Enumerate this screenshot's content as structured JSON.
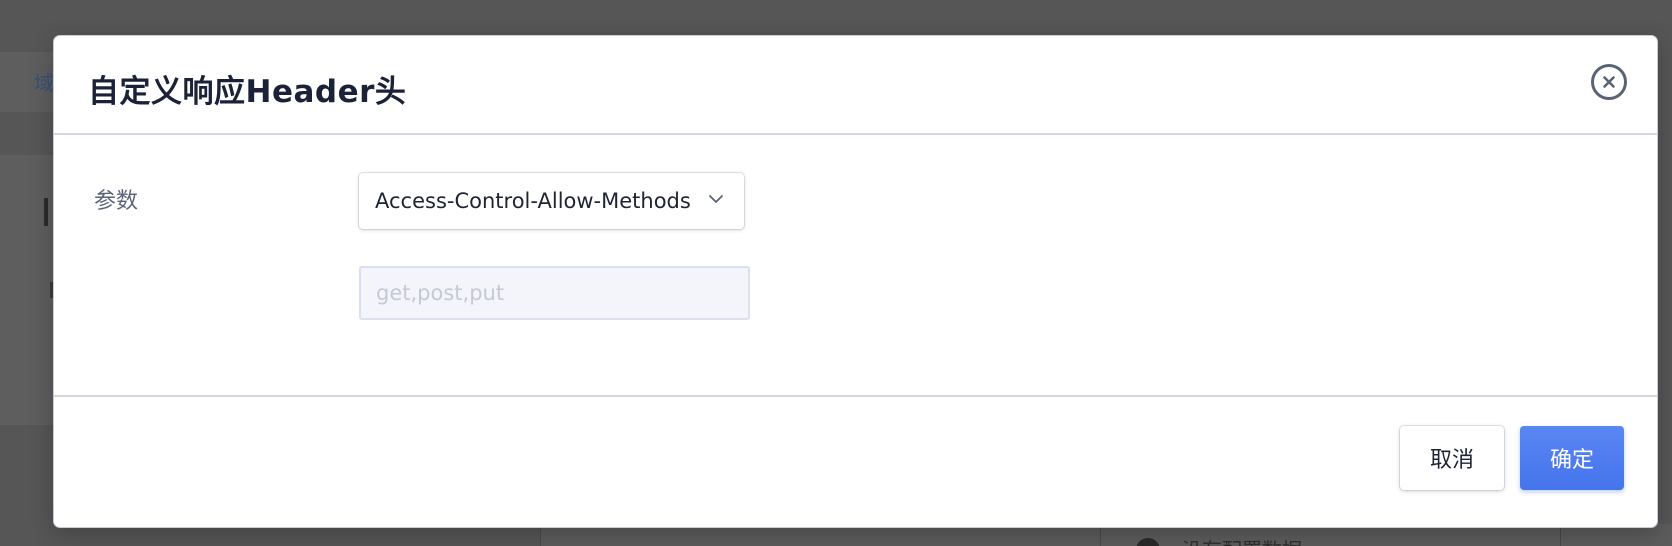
{
  "background": {
    "tab_label": "域",
    "info_text": "没有配置数据"
  },
  "dialog": {
    "title": "自定义响应Header头",
    "close_icon": "close-circle-icon",
    "field_label": "参数",
    "header_select": {
      "selected": "Access-Control-Allow-Methods",
      "icon": "chevron-down-icon"
    },
    "value_input": {
      "value": "",
      "placeholder": "get,post,put"
    },
    "cancel_label": "取消",
    "ok_label": "确定"
  },
  "colors": {
    "primary": "#4a78ee",
    "overlay": "#565656",
    "title_text": "#1b2237"
  }
}
